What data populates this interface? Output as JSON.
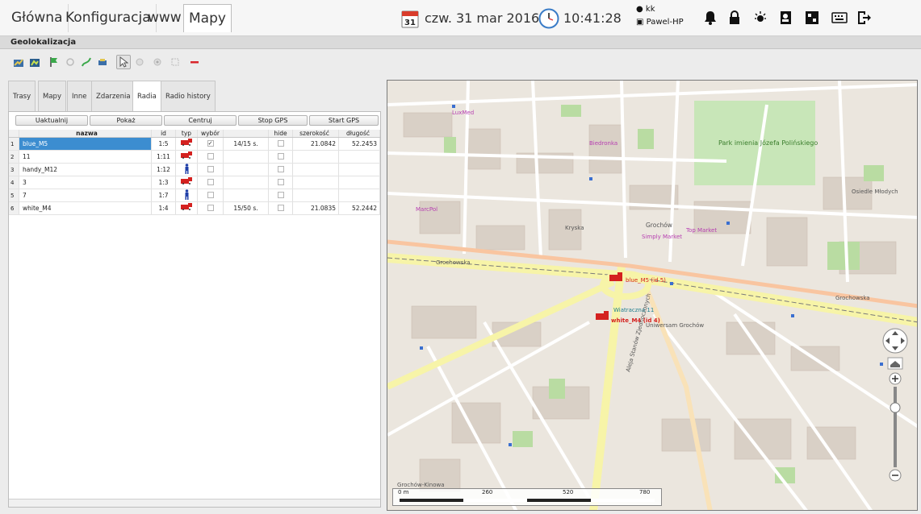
{
  "main_tabs": [
    "Główna",
    "Konfiguracja",
    "www",
    "Mapy"
  ],
  "status": {
    "calendar_day": "31",
    "date": "czw. 31 mar 2016",
    "time": "10:41:28",
    "user": "kk",
    "host": "Pawel-HP"
  },
  "section_title": "Geolokalizacja",
  "sub_tabs": [
    "Trasy",
    "Mapy",
    "Inne",
    "Zdarzenia",
    "Radia",
    "Radio history"
  ],
  "buttons": {
    "update": "Uaktualnij",
    "show": "Pokaż",
    "center": "Centruj",
    "stop_gps": "Stop GPS",
    "start_gps": "Start GPS"
  },
  "table": {
    "headers": {
      "name": "nazwa",
      "id": "id",
      "type": "typ",
      "select": "wybór",
      "hide": "hide",
      "lat": "szerokość",
      "lon": "długość"
    },
    "rows": [
      {
        "num": "1",
        "name": "blue_M5",
        "id": "1:5",
        "type": "truck",
        "selected": true,
        "time": "14/15 s.",
        "hide": false,
        "lat": "21.0842",
        "lon": "52.2453"
      },
      {
        "num": "2",
        "name": "11",
        "id": "1:11",
        "type": "truck",
        "selected": false,
        "time": "",
        "hide": false,
        "lat": "",
        "lon": ""
      },
      {
        "num": "3",
        "name": "handy_M12",
        "id": "1:12",
        "type": "person",
        "selected": false,
        "time": "",
        "hide": false,
        "lat": "",
        "lon": ""
      },
      {
        "num": "4",
        "name": "3",
        "id": "1:3",
        "type": "truck",
        "selected": false,
        "time": "",
        "hide": false,
        "lat": "",
        "lon": ""
      },
      {
        "num": "5",
        "name": "7",
        "id": "1:7",
        "type": "person",
        "selected": false,
        "time": "",
        "hide": false,
        "lat": "",
        "lon": ""
      },
      {
        "num": "6",
        "name": "white_M4",
        "id": "1:4",
        "type": "truck",
        "selected": false,
        "time": "15/50 s.",
        "hide": false,
        "lat": "21.0835",
        "lon": "52.2442"
      }
    ]
  },
  "map": {
    "labels": {
      "park": "Park imienia Józefa Polińskiego",
      "street_main": "Grochowska",
      "street_krypska": "Kryska",
      "grochow": "Grochów",
      "osiedle": "Osiedle Młodych",
      "simply": "Simply Market",
      "top_market": "Top Market",
      "biedronka": "Biedronka",
      "marcpol": "MarcPol",
      "lux": "LuxMed",
      "waszyngtona": "Aleja Stanów Zjednoczonych",
      "wiatraczna": "Wiatraczna 11",
      "grochow_kinowa": "Grochów-Kinowa",
      "vehicle_blue": "blue_M5 (id 5)",
      "vehicle_white": "white_M4 (id 4)",
      "uniwersam": "Uniwersam Grochów"
    },
    "scale": [
      "0 m",
      "260",
      "520",
      "780"
    ]
  }
}
